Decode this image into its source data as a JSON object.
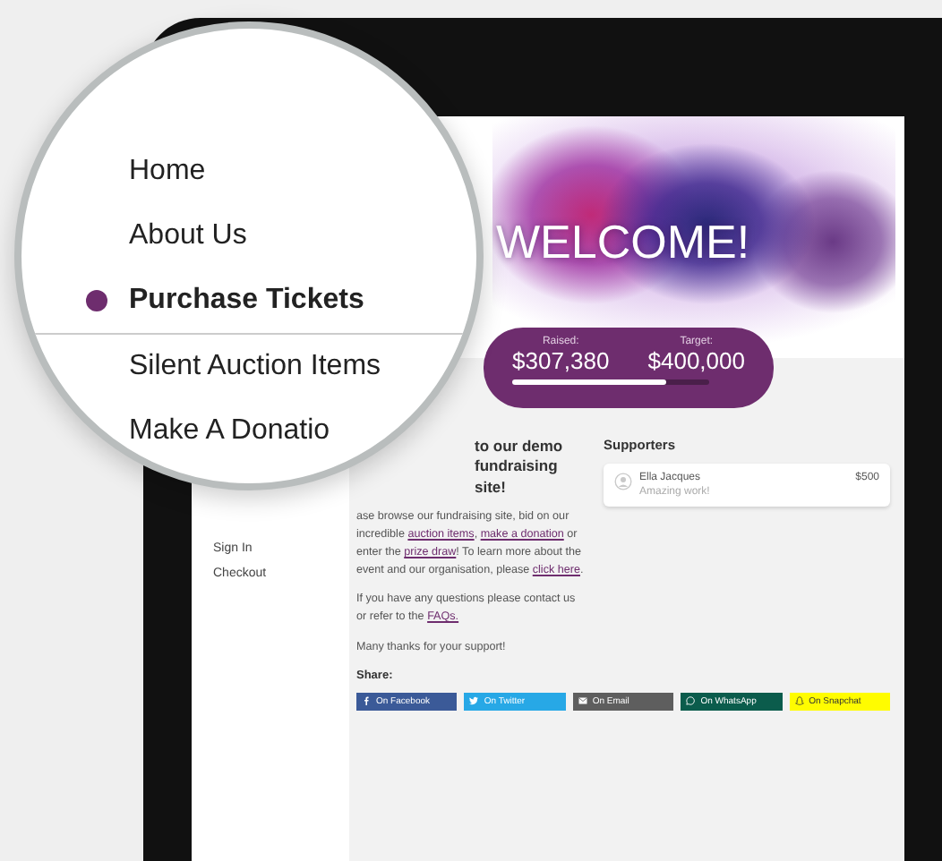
{
  "magnifier": {
    "menu": [
      {
        "label": "Home",
        "selected": false
      },
      {
        "label": "About Us",
        "selected": false
      },
      {
        "label": "Purchase Tickets",
        "selected": true
      }
    ],
    "menu_after_divider": [
      {
        "label": "Silent Auction Items",
        "selected": false
      },
      {
        "label": "Make A Donatio",
        "selected": false
      }
    ]
  },
  "sidebar": {
    "items": [
      "Sign In",
      "Checkout"
    ]
  },
  "hero": {
    "title": "WELCOME!",
    "raised_label": "Raised:",
    "raised": "$307,380",
    "target_label": "Target:",
    "target": "$400,000",
    "level": 0.78
  },
  "intro": {
    "heading": "to our demo fundraising site!",
    "paragraphs": [
      {
        "parts": [
          {
            "text": "ase browse our fundraising site, bid on our incredible ",
            "link": false
          },
          {
            "text": "auction items",
            "link": true
          },
          {
            "text": ", ",
            "link": false
          },
          {
            "text": "make a donation",
            "link": true
          },
          {
            "text": " or enter the ",
            "link": false
          },
          {
            "text": "prize draw",
            "link": true
          },
          {
            "text": "! To learn more about the event and our organisation, please ",
            "link": false
          },
          {
            "text": "click here",
            "link": true
          },
          {
            "text": ".",
            "link": false
          }
        ]
      },
      {
        "parts": [
          {
            "text": "If you have any questions please contact us or refer to the ",
            "link": false
          },
          {
            "text": "FAQs.",
            "link": true
          }
        ]
      },
      {
        "parts": [
          {
            "text": "Many thanks for your support!",
            "link": false
          }
        ]
      }
    ]
  },
  "supporters": {
    "title": "Supporters",
    "items": [
      {
        "name": "Ella Jacques",
        "amount": "$500",
        "message": "Amazing work!"
      }
    ]
  },
  "share": {
    "label": "Share:",
    "buttons": [
      {
        "kind": "facebook",
        "label": "On Facebook",
        "color": "#3b5a98"
      },
      {
        "kind": "twitter",
        "label": "On Twitter",
        "color": "#27a8e6"
      },
      {
        "kind": "email",
        "label": "On Email",
        "color": "#5e5e5e"
      },
      {
        "kind": "whatsapp",
        "label": "On WhatsApp",
        "color": "#0b5c4c"
      },
      {
        "kind": "snapchat",
        "label": "On Snapchat",
        "color": "#fffc00"
      }
    ]
  }
}
